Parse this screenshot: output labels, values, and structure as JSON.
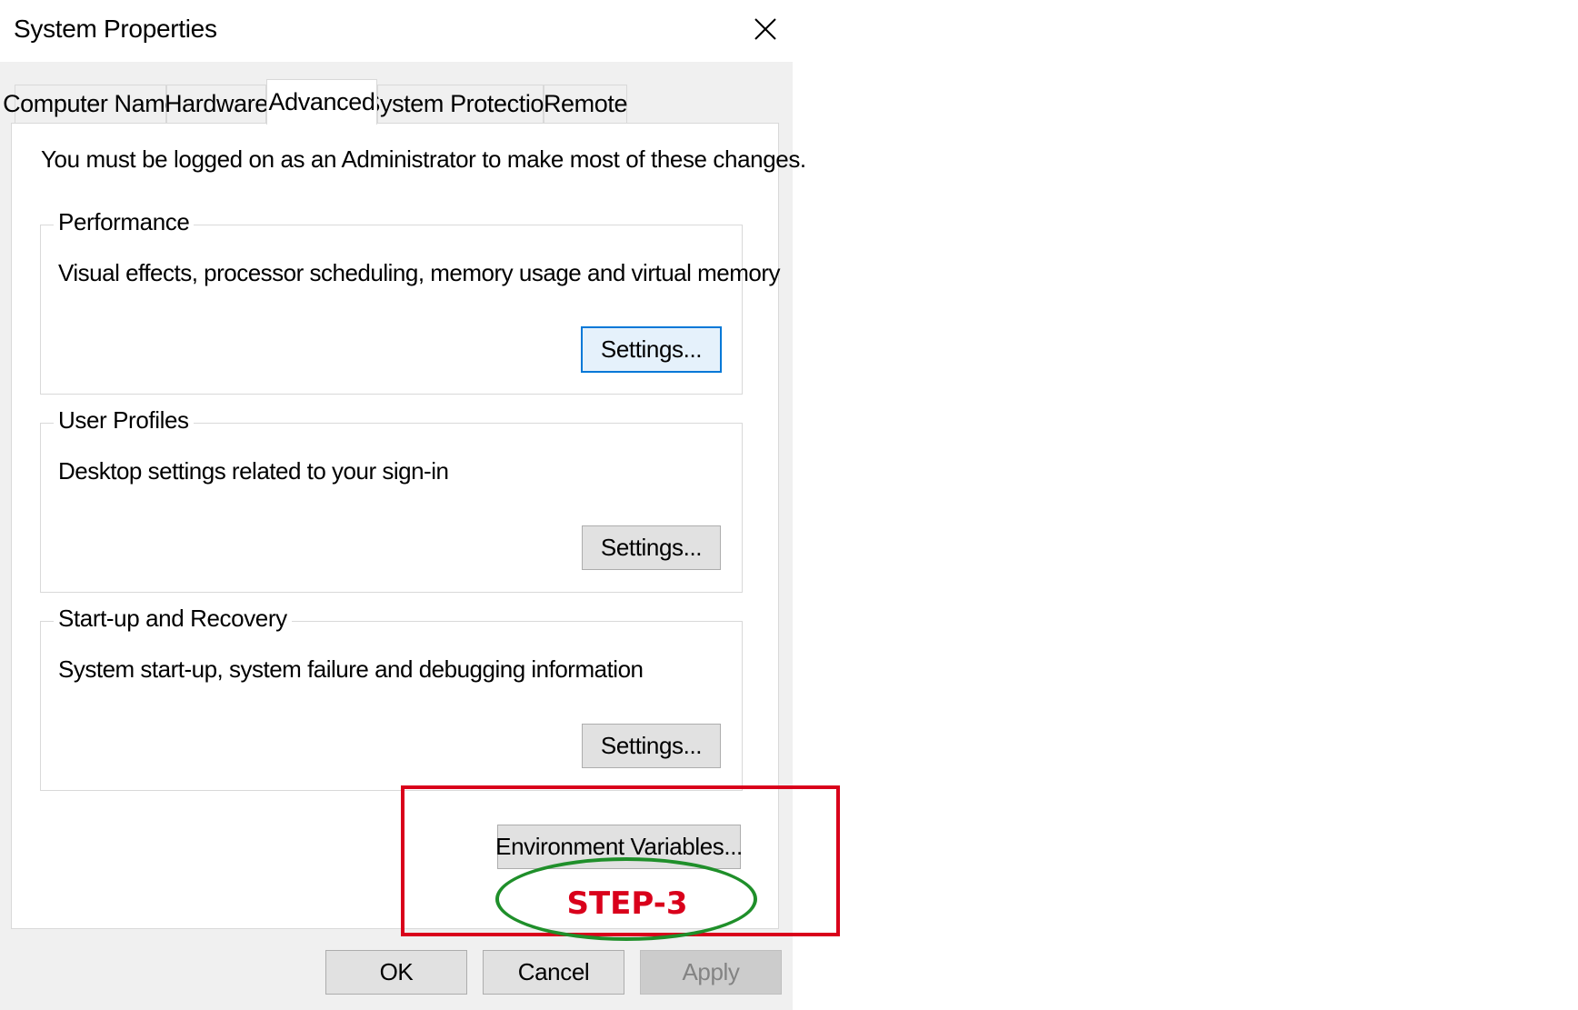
{
  "window": {
    "title": "System Properties",
    "close_icon": "close-icon"
  },
  "tabs": [
    {
      "label": "Computer Name",
      "active": false
    },
    {
      "label": "Hardware",
      "active": false
    },
    {
      "label": "Advanced",
      "active": true
    },
    {
      "label": "System Protection",
      "active": false
    },
    {
      "label": "Remote",
      "active": false
    }
  ],
  "advanced": {
    "notice": "You must be logged on as an Administrator to make most of these changes.",
    "groups": [
      {
        "label": "Performance",
        "description": "Visual effects, processor scheduling, memory usage and virtual memory",
        "button": "Settings...",
        "focused": true
      },
      {
        "label": "User Profiles",
        "description": "Desktop settings related to your sign-in",
        "button": "Settings...",
        "focused": false
      },
      {
        "label": "Start-up and Recovery",
        "description": "System start-up, system failure and debugging information",
        "button": "Settings...",
        "focused": false
      }
    ],
    "env_button": "Environment Variables..."
  },
  "footer": {
    "ok": "OK",
    "cancel": "Cancel",
    "apply": "Apply",
    "apply_disabled": true
  },
  "annotation": {
    "text": "STEP-3",
    "rect_color": "#d9001b",
    "ellipse_color": "#1f8f2a"
  }
}
